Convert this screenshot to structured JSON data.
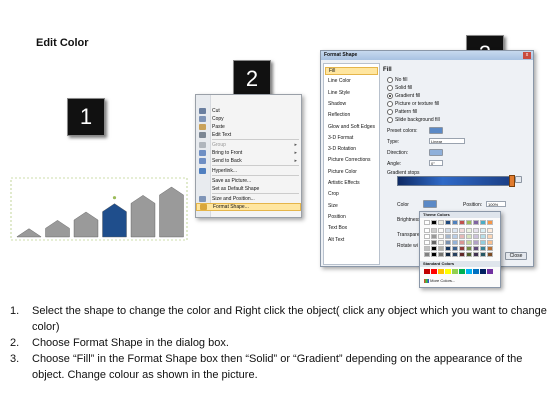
{
  "title": "Edit Color",
  "steps": [
    "1",
    "2",
    "3"
  ],
  "context_menu": {
    "items": [
      {
        "label": "Cut",
        "icon": "scissors-icon",
        "color": "#6a7fa0",
        "disabled": false,
        "arrow": false
      },
      {
        "label": "Copy",
        "icon": "copy-icon",
        "color": "#7f95b8",
        "disabled": false,
        "arrow": false
      },
      {
        "label": "Paste",
        "icon": "paste-icon",
        "color": "#c9a25a",
        "disabled": false,
        "arrow": false
      },
      {
        "label": "Edit Text",
        "icon": "edit-text-icon",
        "color": "#7c8794",
        "disabled": false,
        "arrow": false
      },
      {
        "label": "Group",
        "icon": "group-icon",
        "color": "#b0b6bd",
        "disabled": true,
        "arrow": true
      },
      {
        "label": "Bring to Front",
        "icon": "bring-front-icon",
        "color": "#6f8fc4",
        "disabled": false,
        "arrow": true
      },
      {
        "label": "Send to Back",
        "icon": "send-back-icon",
        "color": "#6f8fc4",
        "disabled": false,
        "arrow": true
      },
      {
        "label": "Hyperlink...",
        "icon": "hyperlink-icon",
        "color": "#4f7fc0",
        "disabled": false,
        "arrow": false
      },
      {
        "label": "Save as Picture...",
        "icon": "",
        "color": "",
        "disabled": false,
        "arrow": false
      },
      {
        "label": "Set as Default Shape",
        "icon": "",
        "color": "",
        "disabled": false,
        "arrow": false
      },
      {
        "label": "Size and Position...",
        "icon": "size-icon",
        "color": "#7f95b8",
        "disabled": false,
        "arrow": false
      },
      {
        "label": "Format Shape...",
        "icon": "format-shape-icon",
        "color": "#d9a63a",
        "disabled": false,
        "arrow": false,
        "highlighted": true
      }
    ]
  },
  "dialog": {
    "title": "Format Shape",
    "close": "x",
    "categories": [
      "Fill",
      "Line Color",
      "Line Style",
      "Shadow",
      "Reflection",
      "Glow and Soft Edges",
      "3-D Format",
      "3-D Rotation",
      "Picture Corrections",
      "Picture Color",
      "Artistic Effects",
      "Crop",
      "Size",
      "Position",
      "Text Box",
      "Alt Text"
    ],
    "selected_category": "Fill",
    "fill_heading": "Fill",
    "fill_options": [
      "No fill",
      "Solid fill",
      "Gradient fill",
      "Picture or texture fill",
      "Pattern fill",
      "Slide background fill"
    ],
    "selected_fill": "Gradient fill",
    "preset_colors_label": "Preset colors:",
    "type_label": "Type:",
    "type_value": "Linear",
    "direction_label": "Direction:",
    "angle_label": "Angle:",
    "angle_value": "0°",
    "gradient_stops_label": "Gradient stops",
    "color_label": "Color",
    "position_label": "Position:",
    "position_value": "100%",
    "brightness_label": "Brightness",
    "transparency_label": "Transparency",
    "rotate_label": "Rotate wi",
    "close_button": "Close"
  },
  "color_popup": {
    "theme_label": "Theme Colors",
    "standard_label": "Standard Colors",
    "more_label": "More Colors...",
    "theme_top": [
      "#ffffff",
      "#000000",
      "#eeece1",
      "#1f497d",
      "#4f81bd",
      "#c0504d",
      "#9bbb59",
      "#8064a2",
      "#4bacc6",
      "#f79646"
    ],
    "standard": [
      "#c00000",
      "#ff0000",
      "#ffc000",
      "#ffff00",
      "#92d050",
      "#00b050",
      "#00b0f0",
      "#0070c0",
      "#002060",
      "#7030a0"
    ]
  },
  "instructions": [
    {
      "num": "1.",
      "text": "Select the shape to change the color and Right click the object( click any object which you want to change color)"
    },
    {
      "num": "2.",
      "text": "Choose Format Shape in the dialog box."
    },
    {
      "num": "3.",
      "text": "Choose “Fill” in the Format Shape box then “Solid” or “Gradient” depending on the appearance of the object. Change colour as shown in the picture."
    }
  ],
  "chart_shapes": {
    "type": "bar",
    "values": [
      1,
      2,
      3,
      4,
      5,
      6
    ],
    "selected_index": 3,
    "colors": {
      "normal": "#9a9a9a",
      "selected": "#1f4e8c"
    }
  }
}
